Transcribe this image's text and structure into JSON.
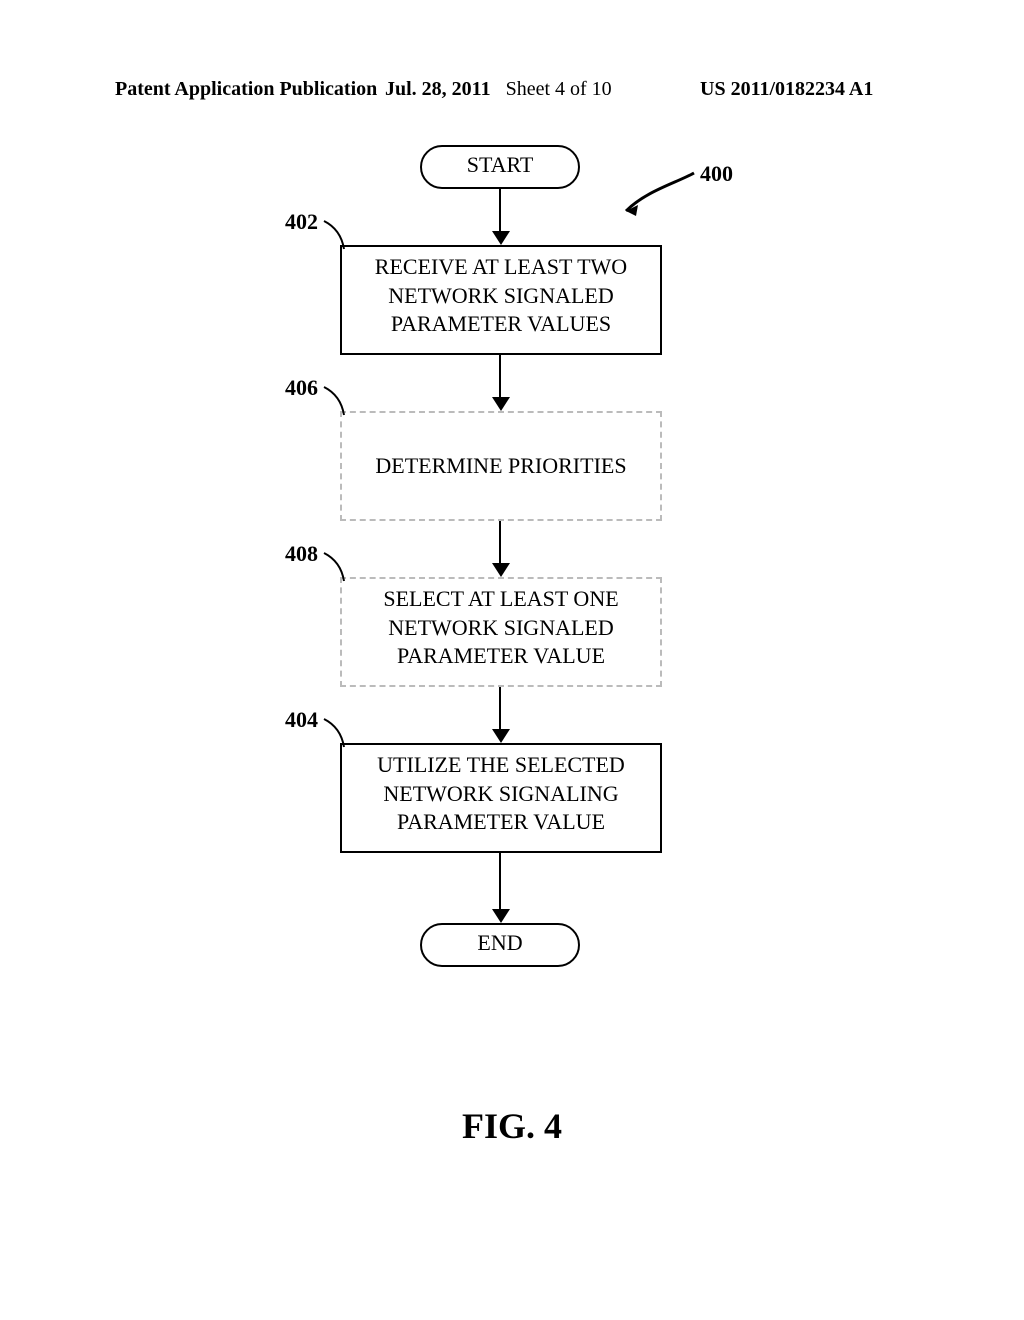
{
  "header": {
    "left": "Patent Application Publication",
    "date": "Jul. 28, 2011",
    "sheet": "Sheet 4 of 10",
    "pubno": "US 2011/0182234 A1"
  },
  "flow": {
    "start": "START",
    "end": "END",
    "box402": "RECEIVE AT LEAST TWO NETWORK SIGNALED PARAMETER VALUES",
    "box406": "DETERMINE PRIORITIES",
    "box408": "SELECT AT LEAST ONE NETWORK SIGNALED PARAMETER VALUE",
    "box404": "UTILIZE THE SELECTED NETWORK SIGNALING PARAMETER VALUE"
  },
  "refs": {
    "r400": "400",
    "r402": "402",
    "r406": "406",
    "r408": "408",
    "r404": "404"
  },
  "caption": "FIG. 4"
}
